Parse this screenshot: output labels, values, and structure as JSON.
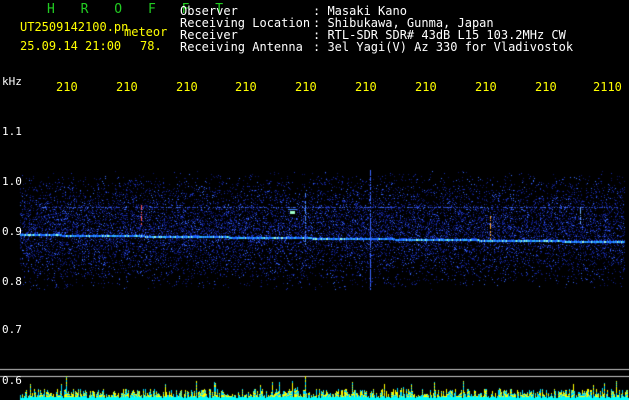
{
  "app": {
    "name": "H R O F F T",
    "file": "UT2509142100.pn",
    "type_label": "meteor",
    "datetime": "25.09.14 21:00",
    "count": "78."
  },
  "info": [
    {
      "label": "Observer",
      "value": ": Masaki Kano"
    },
    {
      "label": "Receiving Location",
      "value": ": Shibukawa, Gunma, Japan"
    },
    {
      "label": "Receiver",
      "value": ": RTL-SDR SDR# 43dB L15 103.2MHz CW"
    },
    {
      "label": "Receiving Antenna",
      "value": ": 3el Yagi(V) Az 330 for Vladivostok"
    }
  ],
  "y_axis": {
    "unit": "kHz",
    "ticks": [
      "1.1",
      "1.0",
      "0.9",
      "0.8",
      "0.7",
      "0.6"
    ]
  },
  "x_axis": {
    "ticks": [
      "210",
      "210",
      "210",
      "210",
      "210",
      "210",
      "210",
      "210",
      "210",
      "2110"
    ]
  },
  "colors": {
    "title_green": "#22cc22",
    "label_yellow": "#ffff00",
    "text_white": "#ffffff",
    "axis_gray": "#c8c8c8"
  }
}
